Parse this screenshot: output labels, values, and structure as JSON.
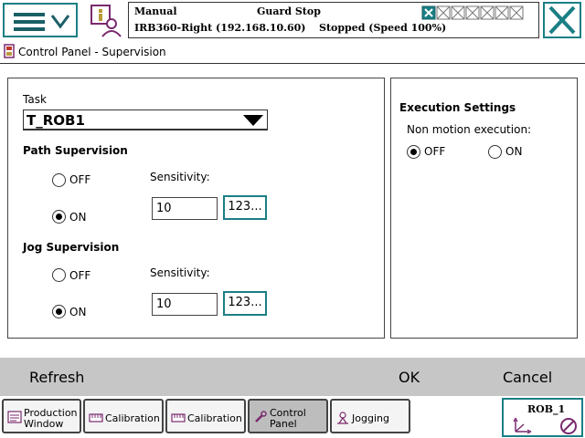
{
  "status": {
    "mode": "Manual",
    "state": "Guard Stop",
    "system": "IRB360-Right (192.168.10.60)",
    "run_state": "Stopped (Speed 100%)"
  },
  "window": {
    "title": "Control Panel - Supervision"
  },
  "task": {
    "label": "Task",
    "value": "T_ROB1"
  },
  "path_supervision": {
    "heading": "Path Supervision",
    "off_label": "OFF",
    "on_label": "ON",
    "selected": "ON",
    "sensitivity_label": "Sensitivity:",
    "sensitivity_value": "10",
    "keypad_label": "123..."
  },
  "jog_supervision": {
    "heading": "Jog Supervision",
    "off_label": "OFF",
    "on_label": "ON",
    "selected": "ON",
    "sensitivity_label": "Sensitivity:",
    "sensitivity_value": "10",
    "keypad_label": "123..."
  },
  "execution_settings": {
    "heading": "Execution Settings",
    "non_motion_label": "Non motion execution:",
    "off_label": "OFF",
    "on_label": "ON",
    "selected": "OFF"
  },
  "commands": {
    "refresh": "Refresh",
    "ok": "OK",
    "cancel": "Cancel"
  },
  "taskbar": {
    "items": [
      {
        "line1": "Production",
        "line2": "Window",
        "icon": "production-window-icon",
        "active": false
      },
      {
        "line1": "Calibration",
        "line2": "",
        "icon": "calibration-icon",
        "active": false
      },
      {
        "line1": "Calibration",
        "line2": "",
        "icon": "calibration-icon",
        "active": false
      },
      {
        "line1": "Control",
        "line2": "Panel",
        "icon": "wrench-icon",
        "active": true
      },
      {
        "line1": "Jogging",
        "line2": "",
        "icon": "jogging-icon",
        "active": false
      }
    ],
    "quickset_label": "ROB_1"
  },
  "colors": {
    "accent": "#1a7f85",
    "command_bar": "#c6c6c6",
    "active_tab": "#bdbdbd"
  }
}
